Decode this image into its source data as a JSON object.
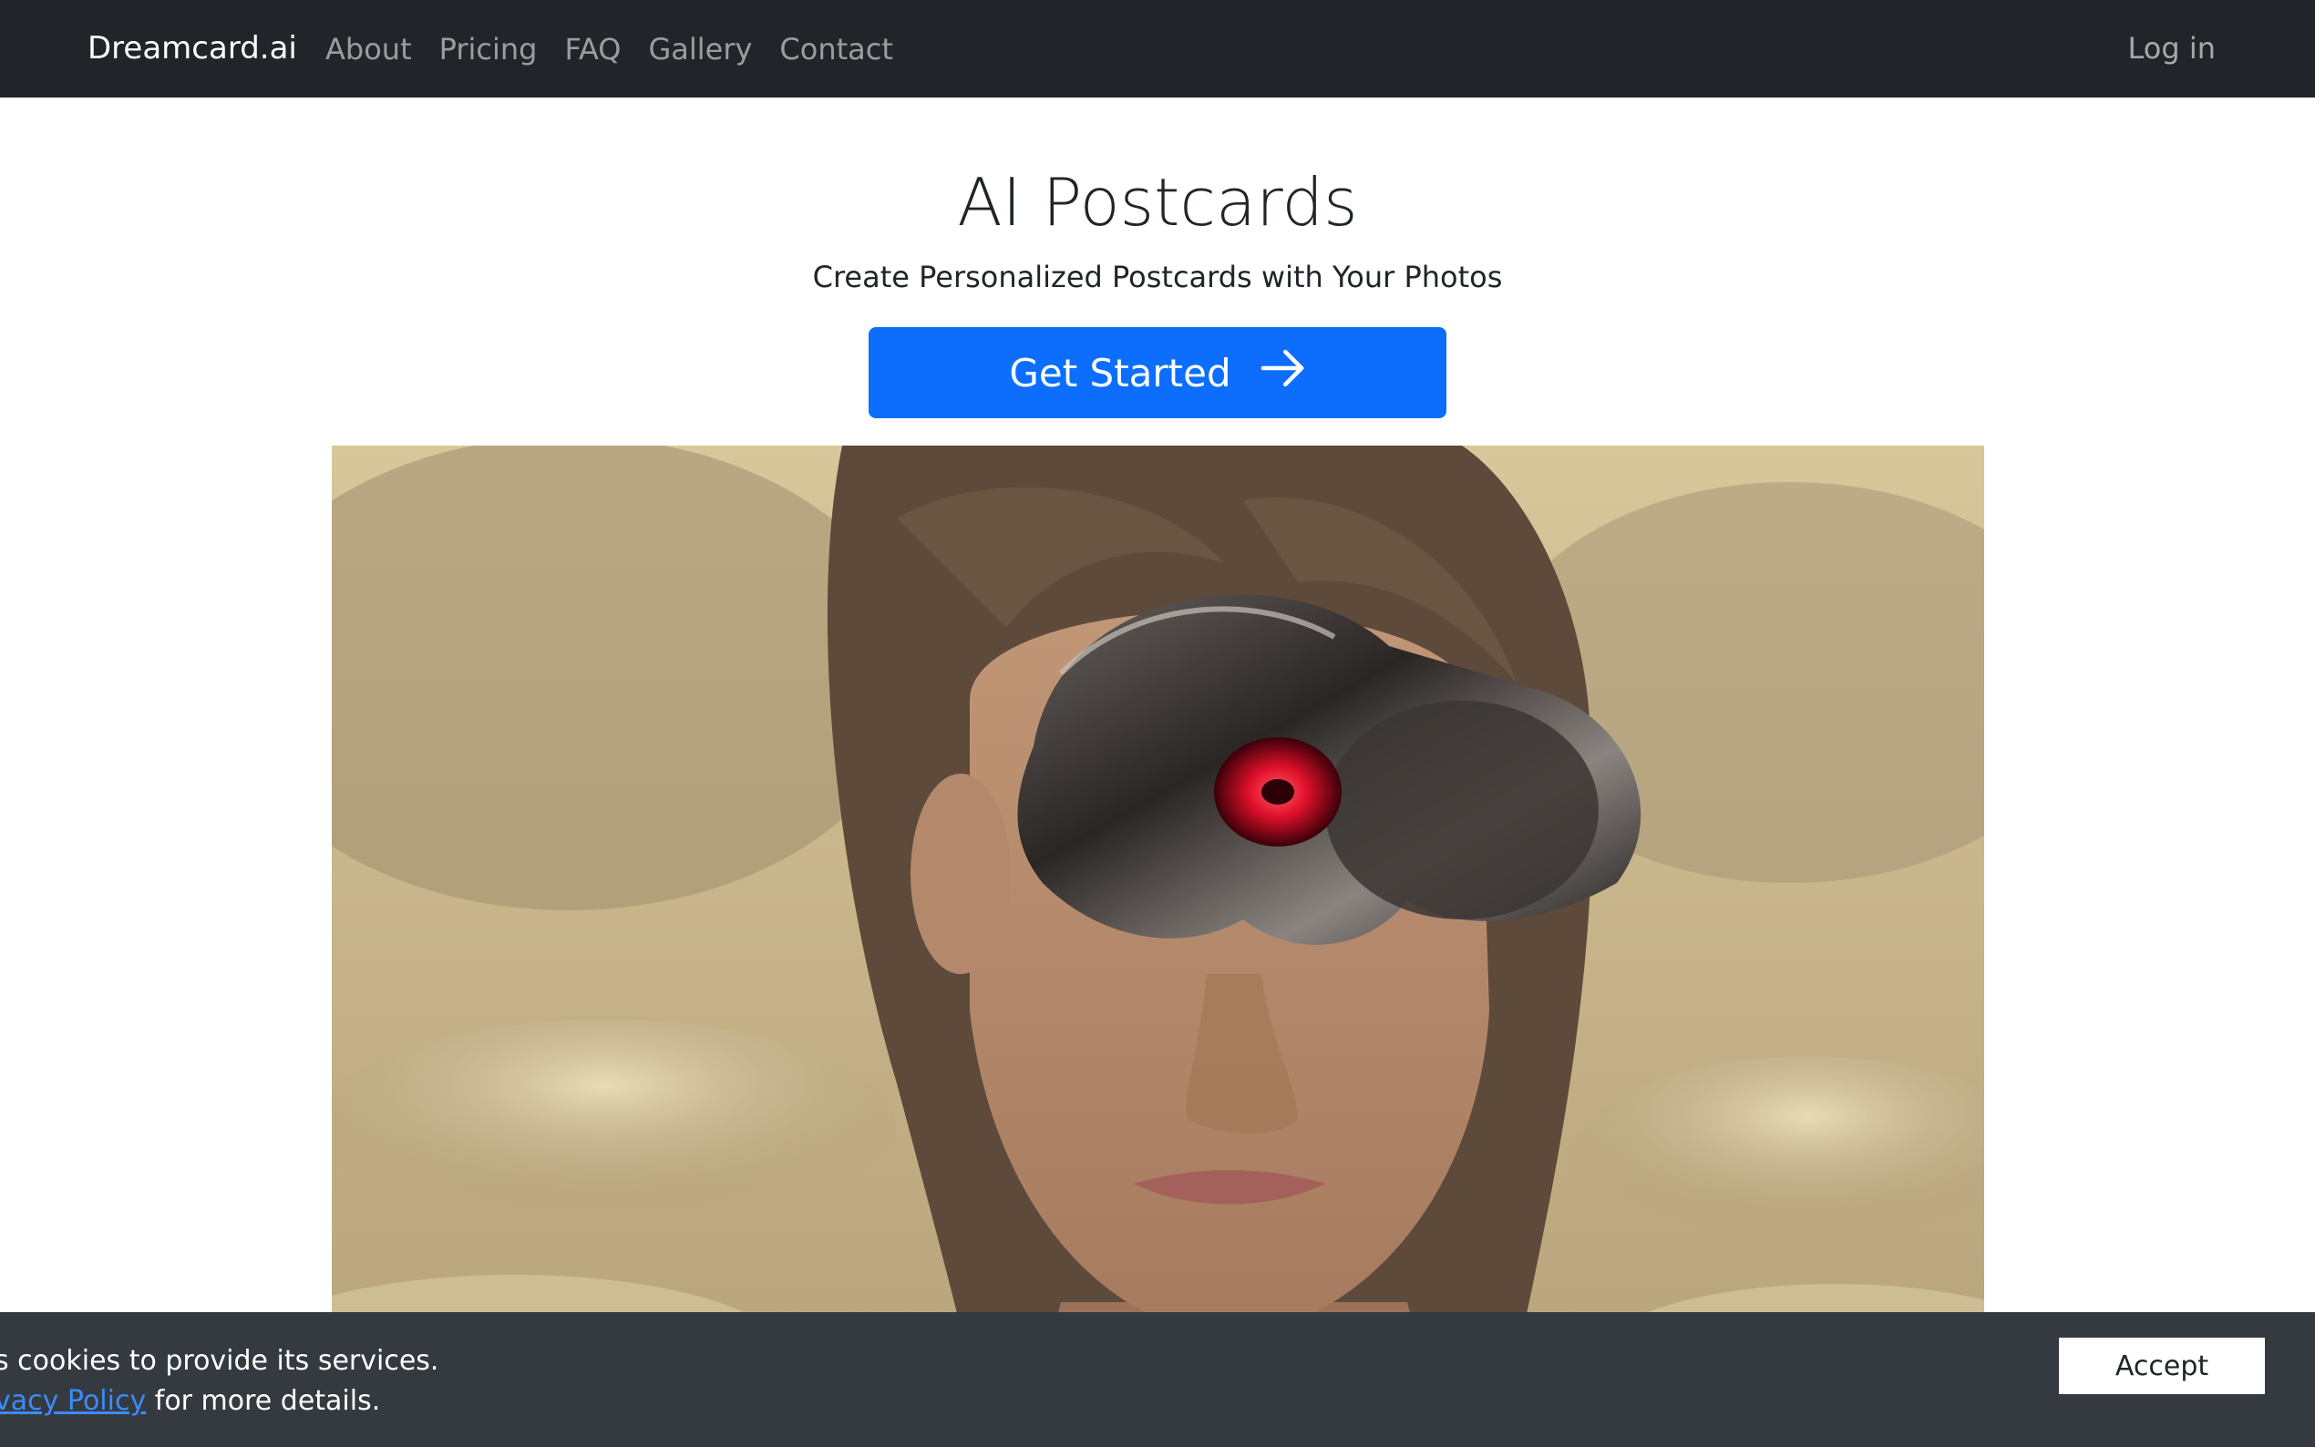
{
  "navbar": {
    "brand": "Dreamcard.ai",
    "links": [
      "About",
      "Pricing",
      "FAQ",
      "Gallery",
      "Contact"
    ],
    "login": "Log in"
  },
  "hero": {
    "title": "AI Postcards",
    "subtitle": "Create Personalized Postcards with Your Photos",
    "cta_label": "Get Started",
    "cta_icon": "arrow-right-icon",
    "image_icon": "portrait-image"
  },
  "cookie": {
    "text_line1": "s cookies to provide its services.",
    "link_text": "vacy Policy",
    "text_line2_suffix": " for more details.",
    "accept_label": "Accept"
  },
  "colors": {
    "navbar_bg": "#212529",
    "primary": "#0d6efd",
    "cookie_bg": "#343a40",
    "link": "#3d8bfd"
  }
}
